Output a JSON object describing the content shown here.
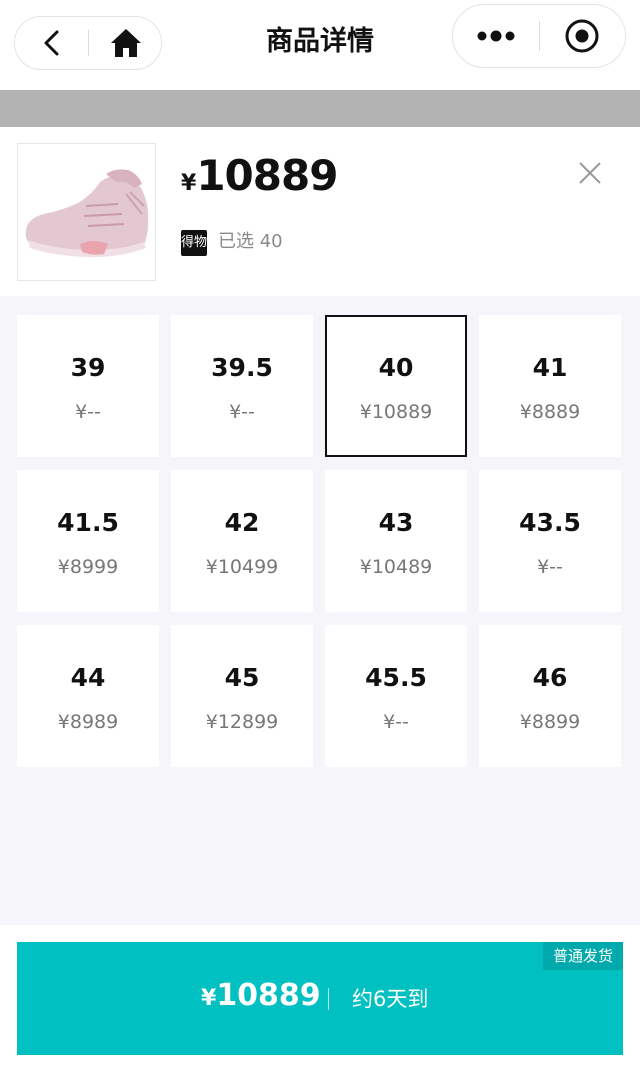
{
  "nav": {
    "title": "商品详情"
  },
  "product": {
    "currency": "¥",
    "price": "10889",
    "brand_badge": "得物",
    "selected_text": "已选 40"
  },
  "sizes": [
    {
      "size": "39",
      "price": "¥--",
      "selected": false
    },
    {
      "size": "39.5",
      "price": "¥--",
      "selected": false
    },
    {
      "size": "40",
      "price": "¥10889",
      "selected": true
    },
    {
      "size": "41",
      "price": "¥8889",
      "selected": false
    },
    {
      "size": "41.5",
      "price": "¥8999",
      "selected": false
    },
    {
      "size": "42",
      "price": "¥10499",
      "selected": false
    },
    {
      "size": "43",
      "price": "¥10489",
      "selected": false
    },
    {
      "size": "43.5",
      "price": "¥--",
      "selected": false
    },
    {
      "size": "44",
      "price": "¥8989",
      "selected": false
    },
    {
      "size": "45",
      "price": "¥12899",
      "selected": false
    },
    {
      "size": "45.5",
      "price": "¥--",
      "selected": false
    },
    {
      "size": "46",
      "price": "¥8899",
      "selected": false
    }
  ],
  "buy": {
    "ship_tag": "普通发货",
    "currency": "¥",
    "price": "10889",
    "eta": "约6天到"
  },
  "colors": {
    "accent": "#00c0c2",
    "accent_dark": "#00a9ab",
    "grid_bg": "#f6f6fa",
    "selected_border": "#111111"
  }
}
